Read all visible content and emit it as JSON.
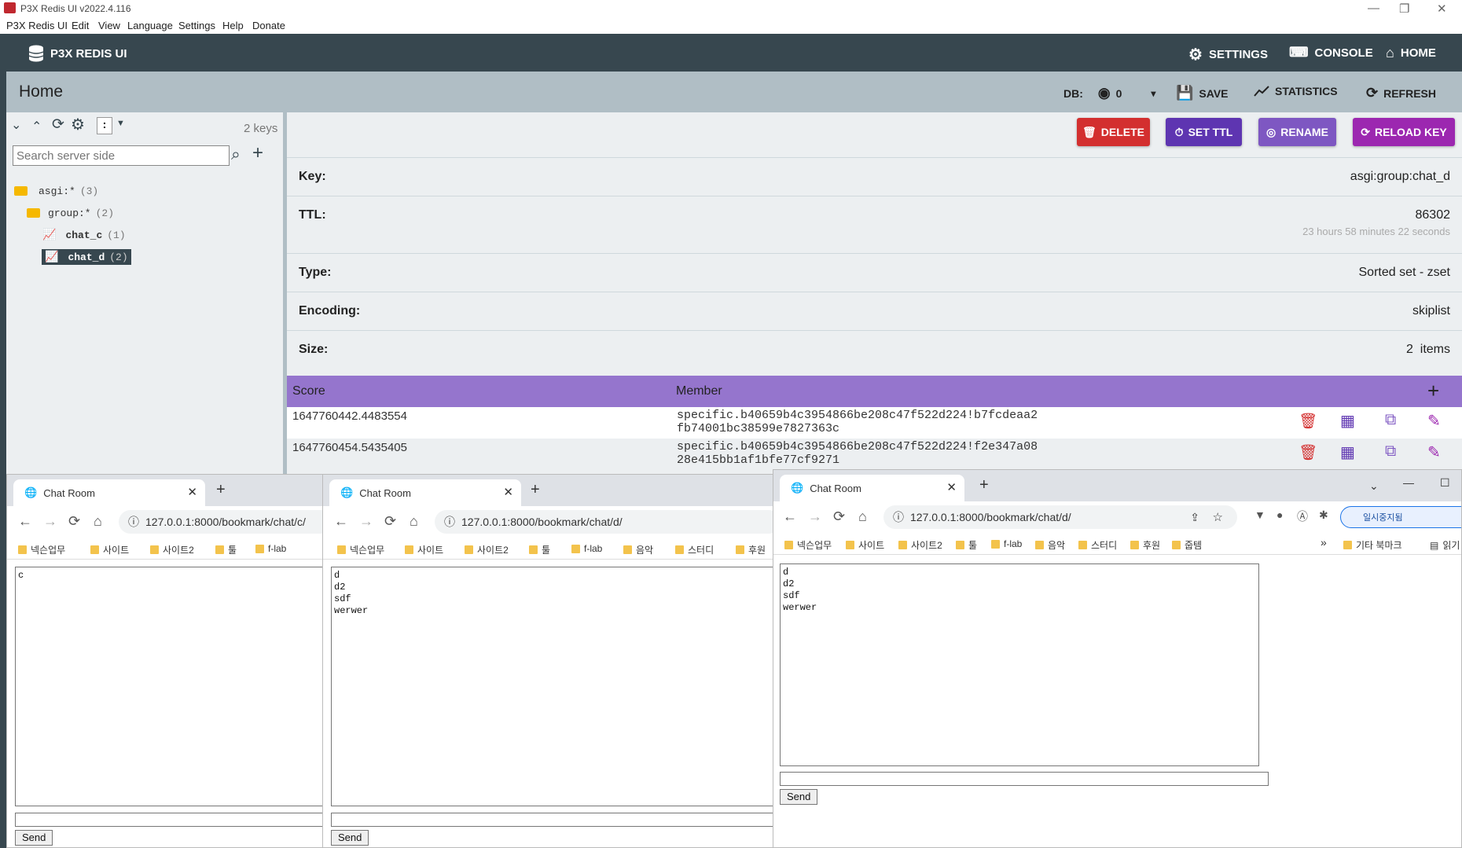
{
  "window": {
    "title": "P3X Redis UI v2022.4.116"
  },
  "menu": [
    "P3X Redis UI",
    "Edit",
    "View",
    "Language",
    "Settings",
    "Help",
    "Donate"
  ],
  "topbar": {
    "brand": "P3X REDIS UI",
    "settings": "SETTINGS",
    "console": "CONSOLE",
    "home": "HOME"
  },
  "homebar": {
    "title": "Home",
    "db_label": "DB:",
    "db_value": "0",
    "save": "SAVE",
    "statistics": "STATISTICS",
    "refresh": "REFRESH"
  },
  "sidebar": {
    "separator": ":",
    "keys_count": "2 keys",
    "search_placeholder": "Search server side",
    "tree": [
      {
        "label": "asgi:*",
        "count": "(3)",
        "kind": "folder"
      },
      {
        "label": "group:*",
        "count": "(2)",
        "kind": "folder"
      },
      {
        "label": "chat_c",
        "count": "(1)",
        "kind": "key"
      },
      {
        "label": "chat_d",
        "count": "(2)",
        "kind": "key",
        "selected": true
      }
    ]
  },
  "actions": {
    "delete": "DELETE",
    "set_ttl": "SET TTL",
    "rename": "RENAME",
    "reload": "RELOAD KEY"
  },
  "key_info": {
    "key_label": "Key:",
    "key_value": "asgi:group:chat_d",
    "ttl_label": "TTL:",
    "ttl_value": "86302",
    "ttl_human": "23 hours 58 minutes 22 seconds",
    "type_label": "Type:",
    "type_value": "Sorted set - zset",
    "encoding_label": "Encoding:",
    "encoding_value": "skiplist",
    "size_label": "Size:",
    "size_value": "2  items"
  },
  "table": {
    "headers": {
      "score": "Score",
      "member": "Member"
    },
    "rows": [
      {
        "score": "1647760442.4483554",
        "member1": "specific.b40659b4c3954866be208c47f522d224!b7fcdeaa2",
        "member2": "fb74001bc38599e7827363c"
      },
      {
        "score": "1647760454.5435405",
        "member1": "specific.b40659b4c3954866be208c47f522d224!f2e347a08",
        "member2": "28e415bb1af1bfe77cf9271"
      }
    ]
  },
  "browsers": [
    {
      "tab": "Chat Room",
      "url": "127.0.0.1:8000/bookmark/chat/c/",
      "log": "c",
      "send": "Send"
    },
    {
      "tab": "Chat Room",
      "url": "127.0.0.1:8000/bookmark/chat/d/",
      "log": "d\nd2\nsdf\nwerwer",
      "send": "Send"
    },
    {
      "tab": "Chat Room",
      "url": "127.0.0.1:8000/bookmark/chat/d/",
      "log": "d\nd2\nsdf\nwerwer",
      "send": "Send"
    }
  ],
  "bookmarks": [
    "넥슨업무",
    "사이트",
    "사이트2",
    "툴",
    "f-lab",
    "음악",
    "스터디",
    "후원",
    "줍템"
  ],
  "bookmarks_other": "기타 북마크",
  "reading_list": "읽기",
  "profile": "일시중지됨",
  "colors": {
    "dark": "#37474f",
    "header": "#b0bec5",
    "delete": "#d32f2f",
    "ttl": "#5e35b1",
    "rename": "#7e57c2",
    "reload": "#9c27b0",
    "table_head": "#9575cd"
  }
}
